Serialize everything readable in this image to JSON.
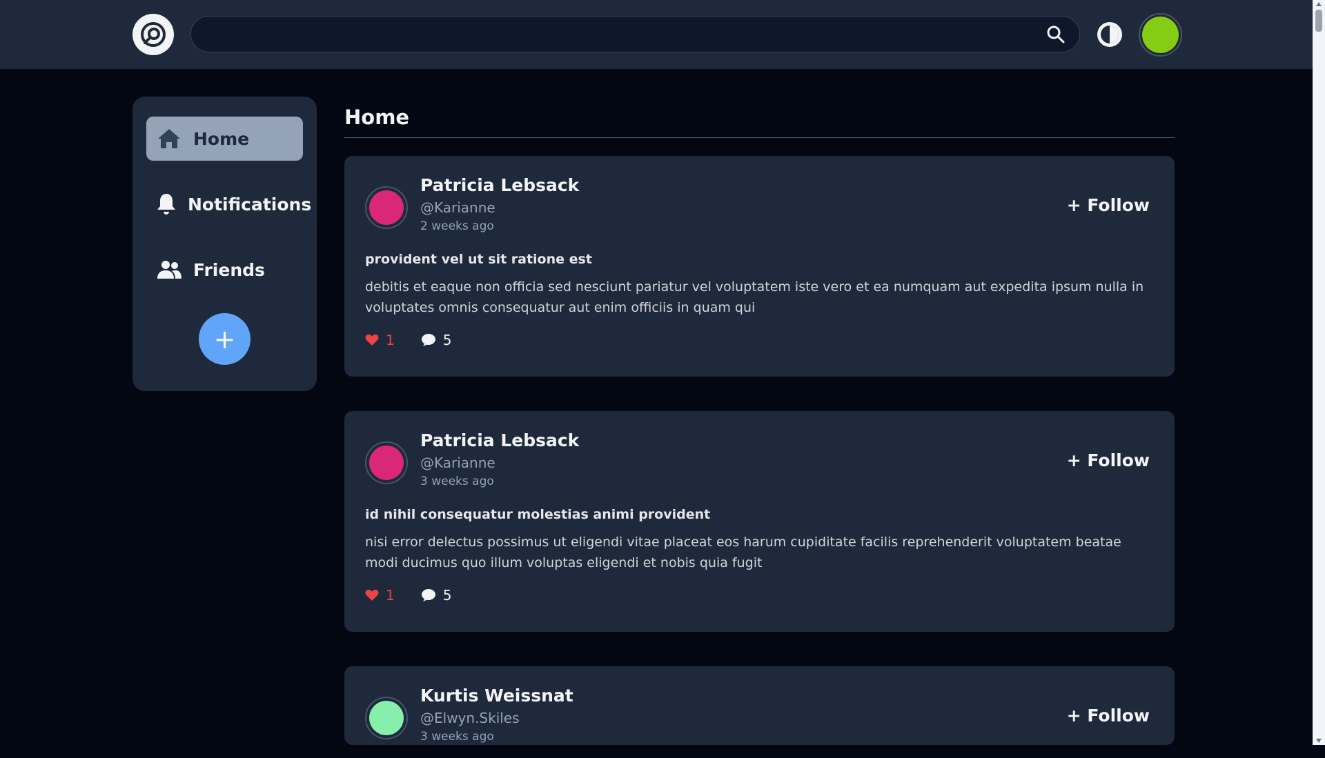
{
  "search": {
    "value": ""
  },
  "nav": {
    "items": [
      {
        "label": "Home",
        "icon": "home-icon",
        "active": true
      },
      {
        "label": "Notifications",
        "icon": "bell-icon",
        "active": false
      },
      {
        "label": "Friends",
        "icon": "users-icon",
        "active": false
      }
    ],
    "add_label": "+"
  },
  "page": {
    "title": "Home"
  },
  "posts": [
    {
      "name": "Patricia Lebsack",
      "handle": "@Karianne",
      "time": "2 weeks ago",
      "follow": "+ Follow",
      "title": "provident vel ut sit ratione est",
      "body": "debitis et eaque non officia sed nesciunt pariatur vel voluptatem iste vero et ea numquam aut expedita ipsum nulla in voluptates omnis consequatur aut enim officiis in quam qui",
      "likes": "1",
      "comments": "5",
      "avatar_color": "#db2777"
    },
    {
      "name": "Patricia Lebsack",
      "handle": "@Karianne",
      "time": "3 weeks ago",
      "follow": "+ Follow",
      "title": "id nihil consequatur molestias animi provident",
      "body": "nisi error delectus possimus ut eligendi vitae placeat eos harum cupiditate facilis reprehenderit voluptatem beatae modi ducimus quo illum voluptas eligendi et nobis quia fugit",
      "likes": "1",
      "comments": "5",
      "avatar_color": "#db2777"
    },
    {
      "name": "Kurtis Weissnat",
      "handle": "@Elwyn.Skiles",
      "time": "3 weeks ago",
      "follow": "+ Follow",
      "avatar_color": "#86efac"
    }
  ],
  "colors": {
    "topbar": "#1e293b",
    "background": "#030712",
    "card": "#1e293b",
    "accent": "#60a5fa",
    "like": "#ef4444",
    "user_avatar": "#84cc16"
  }
}
